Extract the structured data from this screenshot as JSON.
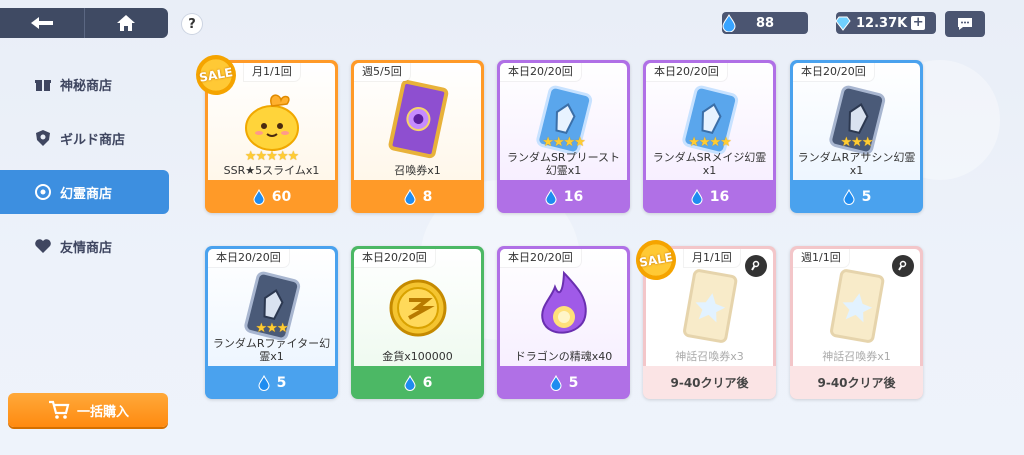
{
  "topbar": {
    "back_icon": "back-arrow-icon",
    "home_icon": "home-icon",
    "help_label": "?",
    "spirit_count": "88",
    "gems_count": "12.37K",
    "gems_plus": "+",
    "chat_icon": "chat-icon"
  },
  "sidebar": {
    "items": [
      {
        "label": "神秘商店",
        "icon": "gift-icon"
      },
      {
        "label": "ギルド商店",
        "icon": "guild-icon"
      },
      {
        "label": "幻霊商店",
        "icon": "spirit-icon",
        "active": true
      },
      {
        "label": "友情商店",
        "icon": "friend-icon"
      }
    ],
    "bulk_label": "一括購入"
  },
  "sale_label": "SALE",
  "cards": [
    {
      "limit": "月1/1回",
      "name": "SSR★5スライムx1",
      "price": "60",
      "theme": "orange",
      "stars": "★★★★★",
      "sale": true
    },
    {
      "limit": "週5/5回",
      "name": "召喚券x1",
      "price": "8",
      "theme": "orange"
    },
    {
      "limit": "本日20/20回",
      "name": "ランダムSRプリースト幻霊x1",
      "price": "16",
      "theme": "purple",
      "stars": "★★★★"
    },
    {
      "limit": "本日20/20回",
      "name": "ランダムSRメイジ幻霊x1",
      "price": "16",
      "theme": "purple",
      "stars": "★★★★"
    },
    {
      "limit": "本日20/20回",
      "name": "ランダムRアサシン幻霊x1",
      "price": "5",
      "theme": "blue",
      "stars": "★★★"
    },
    {
      "limit": "本日20/20回",
      "name": "ランダムRファイター幻霊x1",
      "price": "5",
      "theme": "blue",
      "stars": "★★★"
    },
    {
      "limit": "本日20/20回",
      "name": "金貨x100000",
      "price": "6",
      "theme": "green"
    },
    {
      "limit": "本日20/20回",
      "name": "ドラゴンの精魂x40",
      "price": "5",
      "theme": "purple"
    },
    {
      "limit": "月1/1回",
      "name": "神話召喚券x3",
      "price": "9-40クリア後",
      "theme": "locked",
      "sale": true
    },
    {
      "limit": "週1/1回",
      "name": "神話召喚券x1",
      "price": "9-40クリア後",
      "theme": "locked"
    }
  ],
  "colors": {
    "orange": "#ff9a28",
    "purple": "#b070e6",
    "blue": "#4aa2ee",
    "green": "#4cb865",
    "locked": "#f3c6c9",
    "active_tab": "#3d8fe0"
  }
}
